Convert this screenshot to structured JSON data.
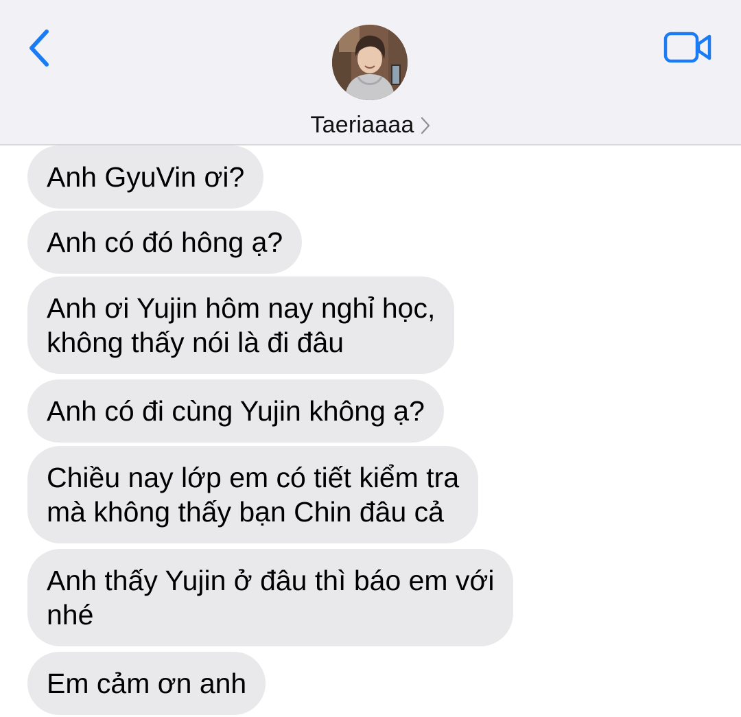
{
  "header": {
    "contact_name": "Taeriaaaa",
    "back_icon": "chevron-left-icon",
    "video_icon": "video-camera-icon",
    "accent_color": "#1a7cf5"
  },
  "messages": [
    {
      "text": "Anh GyuVin ơi?",
      "direction": "incoming"
    },
    {
      "text": "Anh có đó hông ạ?",
      "direction": "incoming"
    },
    {
      "text": "Anh ơi Yujin hôm nay nghỉ học,\nkhông thấy nói là đi đâu",
      "direction": "incoming"
    },
    {
      "text": "Anh có đi cùng Yujin không ạ?",
      "direction": "incoming"
    },
    {
      "text": "Chiều nay lớp em có tiết kiểm tra\nmà không thấy bạn Chin đâu cả",
      "direction": "incoming"
    },
    {
      "text": "Anh thấy Yujin ở đâu thì báo em với\nnhé",
      "direction": "incoming"
    },
    {
      "text": "Em cảm ơn anh",
      "direction": "incoming"
    }
  ]
}
